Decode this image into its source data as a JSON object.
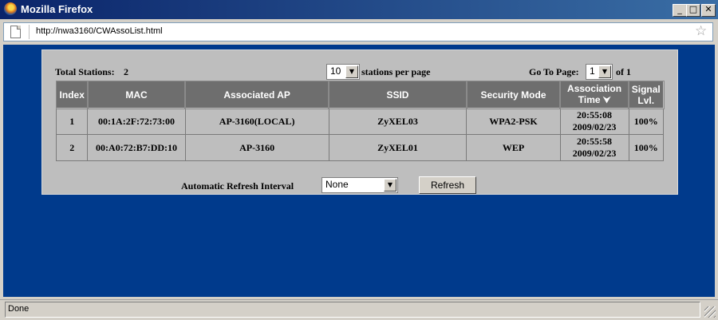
{
  "window": {
    "title": "Mozilla Firefox",
    "min_label": "_",
    "max_label": "□",
    "close_label": "✕"
  },
  "address": {
    "url": "http://nwa3160/CWAssoList.html",
    "star": "☆"
  },
  "header": {
    "total_label": "Total Stations:",
    "total_value": "2",
    "per_page_value": "10",
    "per_page_label": "stations per page",
    "goto_label": "Go To Page:",
    "page_value": "1",
    "of_label": "of 1"
  },
  "table": {
    "headers": [
      "Index",
      "MAC",
      "Associated AP",
      "SSID",
      "Security Mode",
      "Association Time",
      "Signal Lvl."
    ],
    "rows": [
      {
        "index": "1",
        "mac": "00:1A:2F:72:73:00",
        "ap": "AP-3160(LOCAL)",
        "ssid": "ZyXEL03",
        "security": "WPA2-PSK",
        "time": "20:55:08",
        "date": "2009/02/23",
        "signal": "100%"
      },
      {
        "index": "2",
        "mac": "00:A0:72:B7:DD:10",
        "ap": "AP-3160",
        "ssid": "ZyXEL01",
        "security": "WEP",
        "time": "20:55:58",
        "date": "2009/02/23",
        "signal": "100%"
      }
    ]
  },
  "refresh": {
    "label": "Automatic Refresh Interval",
    "interval_value": "None",
    "button_label": "Refresh"
  },
  "status": {
    "text": "Done"
  },
  "icons": {
    "sort": "sort-down-icon",
    "page": "page-icon",
    "bookmark": "star-icon"
  }
}
